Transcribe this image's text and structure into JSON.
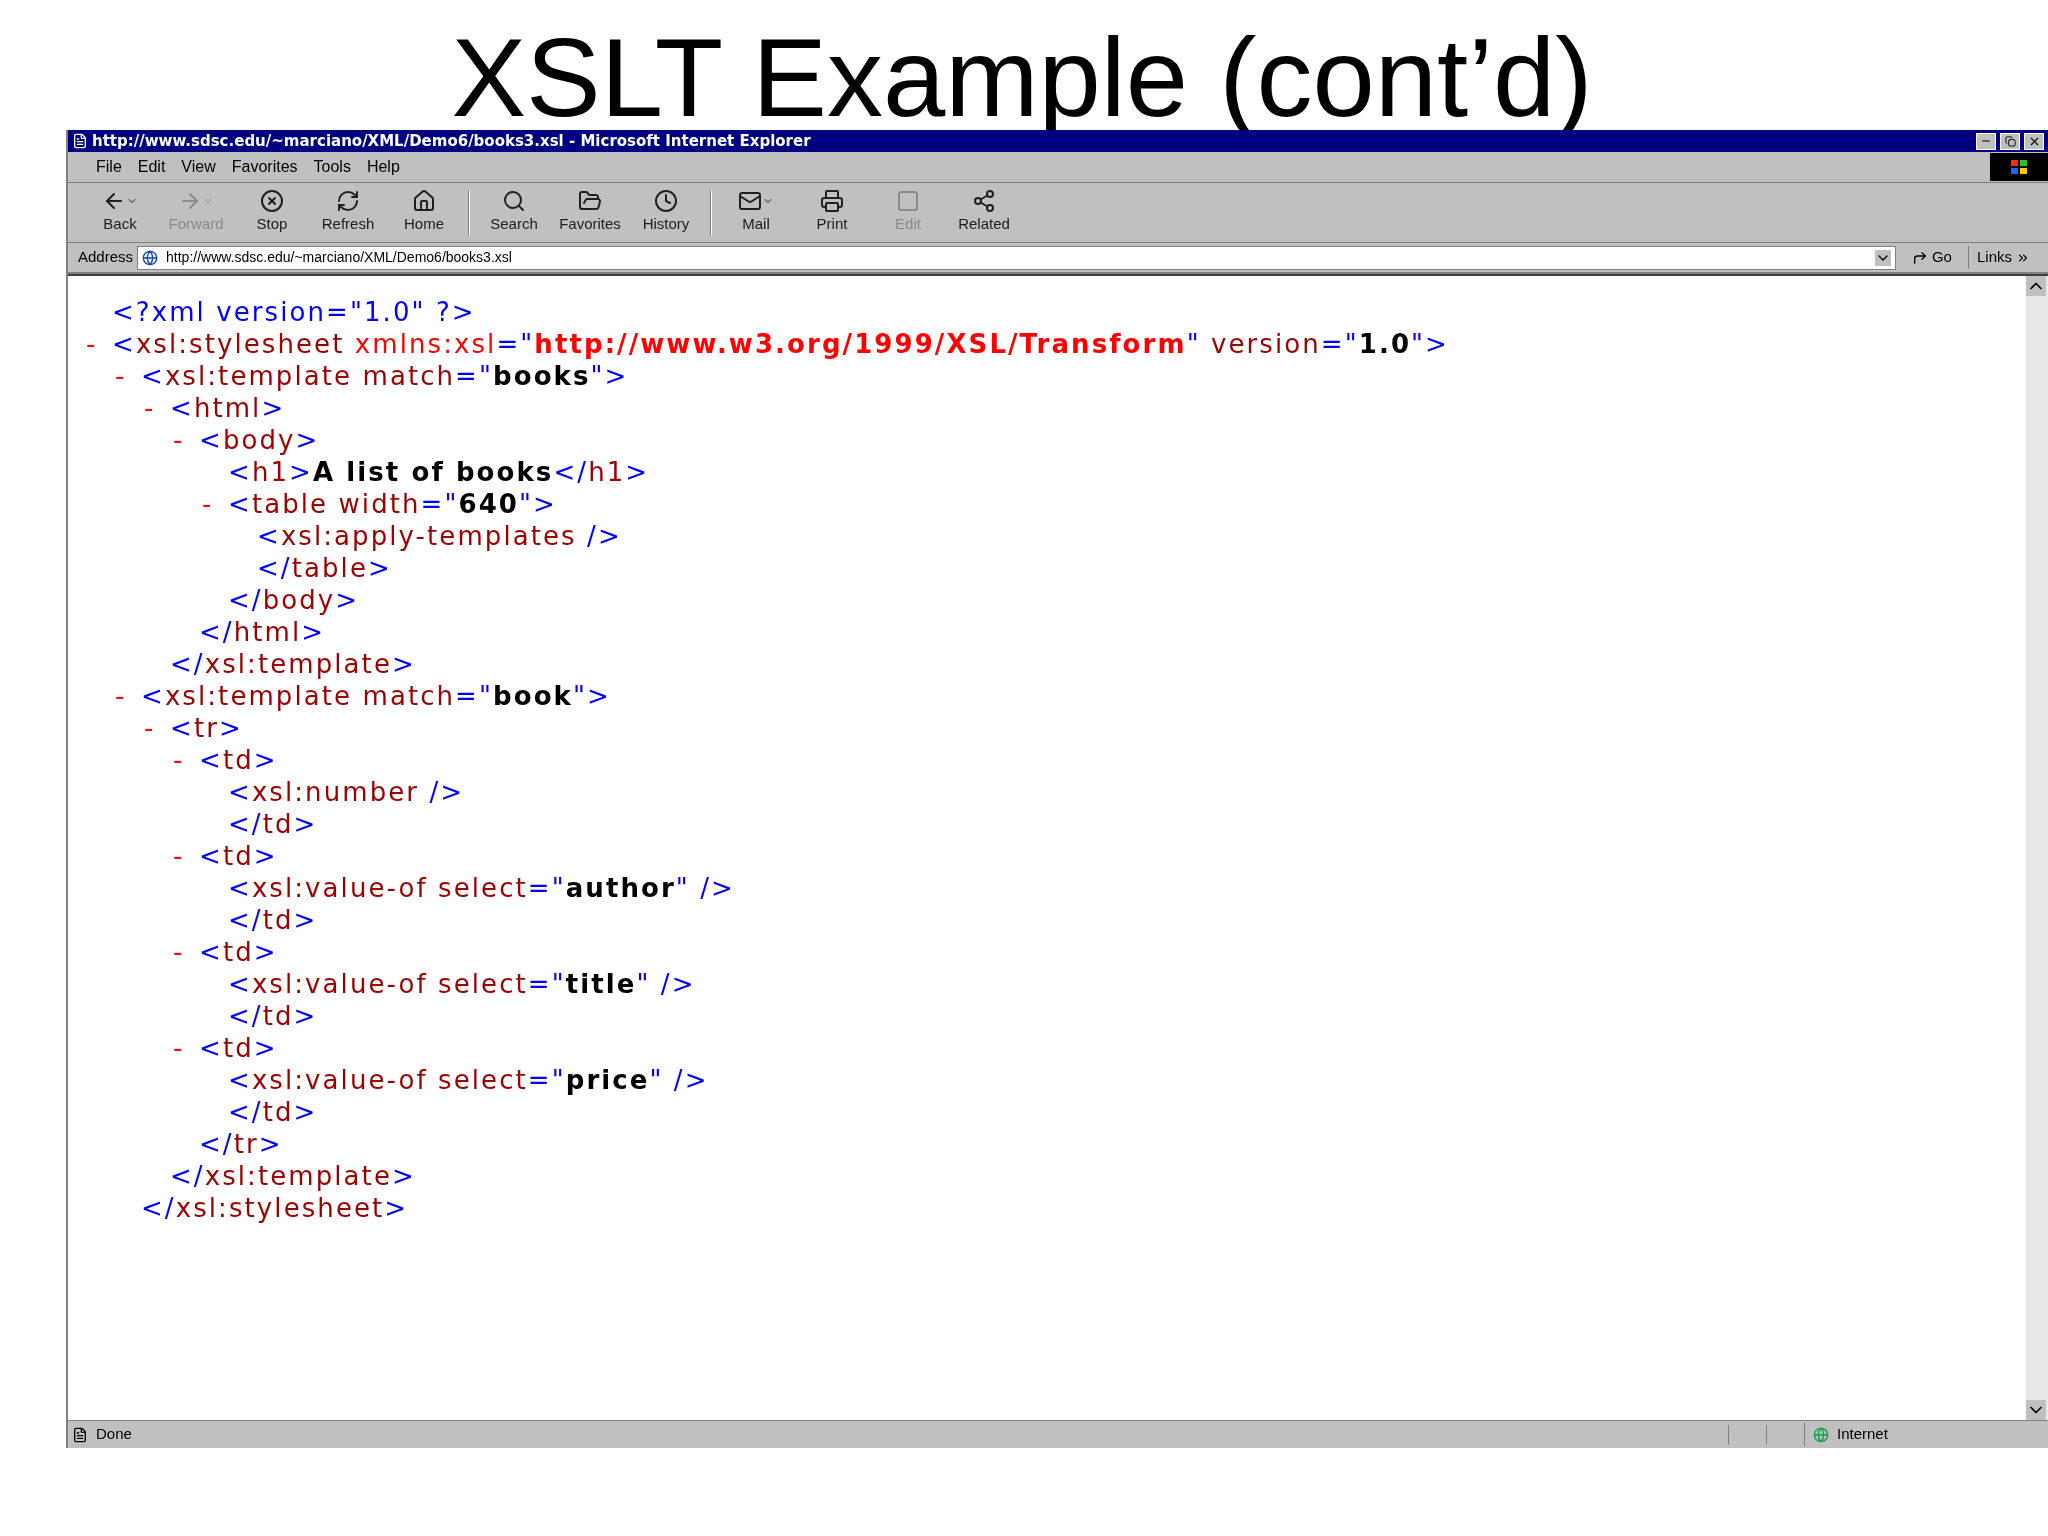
{
  "slide_title": "XSLT Example (cont’d)",
  "window": {
    "title": "http://www.sdsc.edu/~marciano/XML/Demo6/books3.xsl - Microsoft Internet Explorer"
  },
  "menu": [
    "File",
    "Edit",
    "View",
    "Favorites",
    "Tools",
    "Help"
  ],
  "toolbar": [
    {
      "label": "Back",
      "kind": "back",
      "disabled": false,
      "dropdown": true
    },
    {
      "label": "Forward",
      "kind": "forward",
      "disabled": true,
      "dropdown": true
    },
    {
      "label": "Stop",
      "kind": "stop",
      "disabled": false,
      "dropdown": false
    },
    {
      "label": "Refresh",
      "kind": "refresh",
      "disabled": false,
      "dropdown": false
    },
    {
      "label": "Home",
      "kind": "home",
      "disabled": false,
      "dropdown": false
    },
    {
      "label": "Search",
      "kind": "search",
      "disabled": false,
      "dropdown": false
    },
    {
      "label": "Favorites",
      "kind": "favorites",
      "disabled": false,
      "dropdown": false
    },
    {
      "label": "History",
      "kind": "history",
      "disabled": false,
      "dropdown": false
    },
    {
      "label": "Mail",
      "kind": "mail",
      "disabled": false,
      "dropdown": true
    },
    {
      "label": "Print",
      "kind": "print",
      "disabled": false,
      "dropdown": false
    },
    {
      "label": "Edit",
      "kind": "edit",
      "disabled": true,
      "dropdown": false
    },
    {
      "label": "Related",
      "kind": "related",
      "disabled": false,
      "dropdown": false
    }
  ],
  "address": {
    "label": "Address",
    "value": "http://www.sdsc.edu/~marciano/XML/Demo6/books3.xsl",
    "go": "Go",
    "links": "Links"
  },
  "document": [
    {
      "open": [
        {
          "kind": "markup",
          "text": "<?xml version=\"1.0\" ?>"
        }
      ]
    },
    {
      "toggle": "-",
      "open": [
        {
          "kind": "markup",
          "text": "<"
        },
        {
          "kind": "name",
          "text": "xsl:stylesheet"
        },
        {
          "kind": "attr",
          "text": " xmlns:xsl"
        },
        {
          "kind": "markup",
          "text": "=\""
        },
        {
          "kind": "url",
          "text": "http://www.w3.org/1999/XSL/Transform"
        },
        {
          "kind": "markup",
          "text": "\""
        },
        {
          "kind": "name",
          "text": " version"
        },
        {
          "kind": "markup",
          "text": "=\""
        },
        {
          "kind": "value",
          "text": "1.0"
        },
        {
          "kind": "markup",
          "text": "\">"
        }
      ],
      "children": [
        {
          "toggle": "-",
          "open": [
            {
              "kind": "markup",
              "text": "<"
            },
            {
              "kind": "name",
              "text": "xsl:template"
            },
            {
              "kind": "name",
              "text": " match"
            },
            {
              "kind": "markup",
              "text": "=\""
            },
            {
              "kind": "value",
              "text": "books"
            },
            {
              "kind": "markup",
              "text": "\">"
            }
          ],
          "children": [
            {
              "toggle": "-",
              "open": [
                {
                  "kind": "markup",
                  "text": "<"
                },
                {
                  "kind": "name",
                  "text": "html"
                },
                {
                  "kind": "markup",
                  "text": ">"
                }
              ],
              "children": [
                {
                  "toggle": "-",
                  "open": [
                    {
                      "kind": "markup",
                      "text": "<"
                    },
                    {
                      "kind": "name",
                      "text": "body"
                    },
                    {
                      "kind": "markup",
                      "text": ">"
                    }
                  ],
                  "children": [
                    {
                      "open": [
                        {
                          "kind": "markup",
                          "text": "<"
                        },
                        {
                          "kind": "name",
                          "text": "h1"
                        },
                        {
                          "kind": "markup",
                          "text": ">"
                        },
                        {
                          "kind": "value",
                          "text": "A list of books"
                        },
                        {
                          "kind": "markup",
                          "text": "</"
                        },
                        {
                          "kind": "name",
                          "text": "h1"
                        },
                        {
                          "kind": "markup",
                          "text": ">"
                        }
                      ]
                    },
                    {
                      "toggle": "-",
                      "open": [
                        {
                          "kind": "markup",
                          "text": "<"
                        },
                        {
                          "kind": "name",
                          "text": "table"
                        },
                        {
                          "kind": "name",
                          "text": " width"
                        },
                        {
                          "kind": "markup",
                          "text": "=\""
                        },
                        {
                          "kind": "value",
                          "text": "640"
                        },
                        {
                          "kind": "markup",
                          "text": "\">"
                        }
                      ],
                      "children": [
                        {
                          "open": [
                            {
                              "kind": "markup",
                              "text": "<"
                            },
                            {
                              "kind": "name",
                              "text": "xsl:apply-templates"
                            },
                            {
                              "kind": "markup",
                              "text": " />"
                            }
                          ]
                        }
                      ],
                      "close": [
                        {
                          "kind": "markup",
                          "text": "</"
                        },
                        {
                          "kind": "name",
                          "text": "table"
                        },
                        {
                          "kind": "markup",
                          "text": ">"
                        }
                      ]
                    }
                  ],
                  "close": [
                    {
                      "kind": "markup",
                      "text": "</"
                    },
                    {
                      "kind": "name",
                      "text": "body"
                    },
                    {
                      "kind": "markup",
                      "text": ">"
                    }
                  ]
                }
              ],
              "close": [
                {
                  "kind": "markup",
                  "text": "</"
                },
                {
                  "kind": "name",
                  "text": "html"
                },
                {
                  "kind": "markup",
                  "text": ">"
                }
              ]
            }
          ],
          "close": [
            {
              "kind": "markup",
              "text": "</"
            },
            {
              "kind": "name",
              "text": "xsl:template"
            },
            {
              "kind": "markup",
              "text": ">"
            }
          ]
        },
        {
          "toggle": "-",
          "open": [
            {
              "kind": "markup",
              "text": "<"
            },
            {
              "kind": "name",
              "text": "xsl:template"
            },
            {
              "kind": "name",
              "text": " match"
            },
            {
              "kind": "markup",
              "text": "=\""
            },
            {
              "kind": "value",
              "text": "book"
            },
            {
              "kind": "markup",
              "text": "\">"
            }
          ],
          "children": [
            {
              "toggle": "-",
              "open": [
                {
                  "kind": "markup",
                  "text": "<"
                },
                {
                  "kind": "name",
                  "text": "tr"
                },
                {
                  "kind": "markup",
                  "text": ">"
                }
              ],
              "children": [
                {
                  "toggle": "-",
                  "open": [
                    {
                      "kind": "markup",
                      "text": "<"
                    },
                    {
                      "kind": "name",
                      "text": "td"
                    },
                    {
                      "kind": "markup",
                      "text": ">"
                    }
                  ],
                  "children": [
                    {
                      "open": [
                        {
                          "kind": "markup",
                          "text": "<"
                        },
                        {
                          "kind": "name",
                          "text": "xsl:number"
                        },
                        {
                          "kind": "markup",
                          "text": " />"
                        }
                      ]
                    }
                  ],
                  "close": [
                    {
                      "kind": "markup",
                      "text": "</"
                    },
                    {
                      "kind": "name",
                      "text": "td"
                    },
                    {
                      "kind": "markup",
                      "text": ">"
                    }
                  ]
                },
                {
                  "toggle": "-",
                  "open": [
                    {
                      "kind": "markup",
                      "text": "<"
                    },
                    {
                      "kind": "name",
                      "text": "td"
                    },
                    {
                      "kind": "markup",
                      "text": ">"
                    }
                  ],
                  "children": [
                    {
                      "open": [
                        {
                          "kind": "markup",
                          "text": "<"
                        },
                        {
                          "kind": "name",
                          "text": "xsl:value-of"
                        },
                        {
                          "kind": "name",
                          "text": " select"
                        },
                        {
                          "kind": "markup",
                          "text": "=\""
                        },
                        {
                          "kind": "value",
                          "text": "author"
                        },
                        {
                          "kind": "markup",
                          "text": "\" />"
                        }
                      ]
                    }
                  ],
                  "close": [
                    {
                      "kind": "markup",
                      "text": "</"
                    },
                    {
                      "kind": "name",
                      "text": "td"
                    },
                    {
                      "kind": "markup",
                      "text": ">"
                    }
                  ]
                },
                {
                  "toggle": "-",
                  "open": [
                    {
                      "kind": "markup",
                      "text": "<"
                    },
                    {
                      "kind": "name",
                      "text": "td"
                    },
                    {
                      "kind": "markup",
                      "text": ">"
                    }
                  ],
                  "children": [
                    {
                      "open": [
                        {
                          "kind": "markup",
                          "text": "<"
                        },
                        {
                          "kind": "name",
                          "text": "xsl:value-of"
                        },
                        {
                          "kind": "name",
                          "text": " select"
                        },
                        {
                          "kind": "markup",
                          "text": "=\""
                        },
                        {
                          "kind": "value",
                          "text": "title"
                        },
                        {
                          "kind": "markup",
                          "text": "\" />"
                        }
                      ]
                    }
                  ],
                  "close": [
                    {
                      "kind": "markup",
                      "text": "</"
                    },
                    {
                      "kind": "name",
                      "text": "td"
                    },
                    {
                      "kind": "markup",
                      "text": ">"
                    }
                  ]
                },
                {
                  "toggle": "-",
                  "open": [
                    {
                      "kind": "markup",
                      "text": "<"
                    },
                    {
                      "kind": "name",
                      "text": "td"
                    },
                    {
                      "kind": "markup",
                      "text": ">"
                    }
                  ],
                  "children": [
                    {
                      "open": [
                        {
                          "kind": "markup",
                          "text": "<"
                        },
                        {
                          "kind": "name",
                          "text": "xsl:value-of"
                        },
                        {
                          "kind": "name",
                          "text": " select"
                        },
                        {
                          "kind": "markup",
                          "text": "=\""
                        },
                        {
                          "kind": "value",
                          "text": "price"
                        },
                        {
                          "kind": "markup",
                          "text": "\" />"
                        }
                      ]
                    }
                  ],
                  "close": [
                    {
                      "kind": "markup",
                      "text": "</"
                    },
                    {
                      "kind": "name",
                      "text": "td"
                    },
                    {
                      "kind": "markup",
                      "text": ">"
                    }
                  ]
                }
              ],
              "close": [
                {
                  "kind": "markup",
                  "text": "</"
                },
                {
                  "kind": "name",
                  "text": "tr"
                },
                {
                  "kind": "markup",
                  "text": ">"
                }
              ]
            }
          ],
          "close": [
            {
              "kind": "markup",
              "text": "</"
            },
            {
              "kind": "name",
              "text": "xsl:template"
            },
            {
              "kind": "markup",
              "text": ">"
            }
          ]
        }
      ],
      "close": [
        {
          "kind": "markup",
          "text": "</"
        },
        {
          "kind": "name",
          "text": "xsl:stylesheet"
        },
        {
          "kind": "markup",
          "text": ">"
        }
      ]
    }
  ],
  "status_bar": {
    "text": "Done",
    "zone": "Internet"
  }
}
